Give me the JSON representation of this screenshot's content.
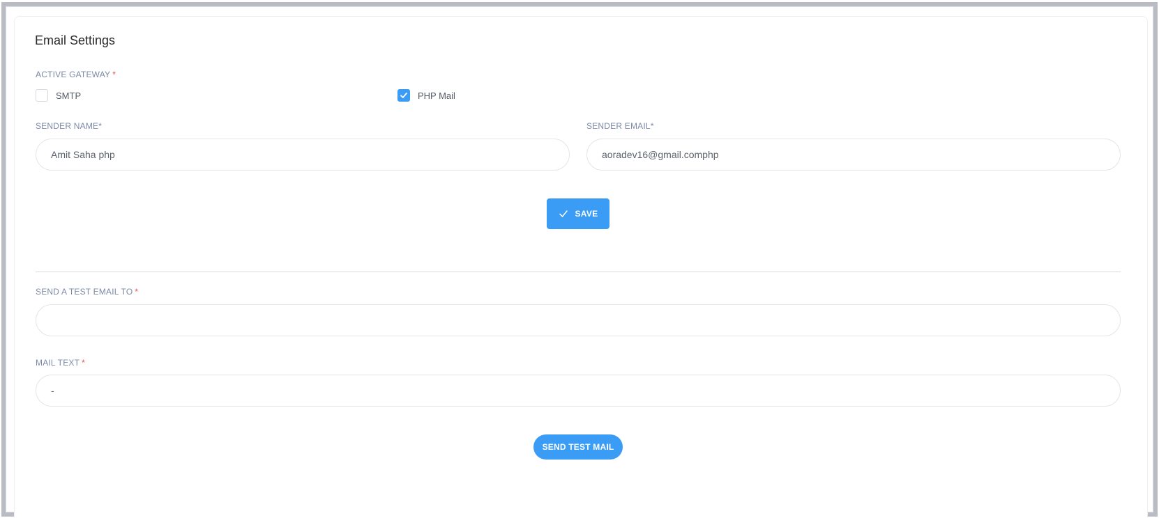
{
  "page": {
    "title": "Email Settings"
  },
  "gateway": {
    "label": "ACTIVE GATEWAY",
    "required_mark": "*",
    "options": [
      {
        "label": "SMTP",
        "checked": false
      },
      {
        "label": "PHP Mail",
        "checked": true
      }
    ]
  },
  "sender_name": {
    "label": "SENDER NAME*",
    "value": "Amit Saha php"
  },
  "sender_email": {
    "label": "SENDER EMAIL*",
    "value": "aoradev16@gmail.comphp"
  },
  "save_button": {
    "label": "SAVE",
    "icon": "check-icon"
  },
  "test_email": {
    "label": "SEND A TEST EMAIL TO",
    "required_mark": "*",
    "value": ""
  },
  "mail_text": {
    "label": "MAIL TEXT",
    "required_mark": "*",
    "value": "-"
  },
  "send_button": {
    "label": "SEND TEST MAIL"
  },
  "colors": {
    "accent": "#3a9cf5",
    "label": "#7b89a8",
    "required": "#e0504a",
    "frame": "#b9bdc3"
  }
}
